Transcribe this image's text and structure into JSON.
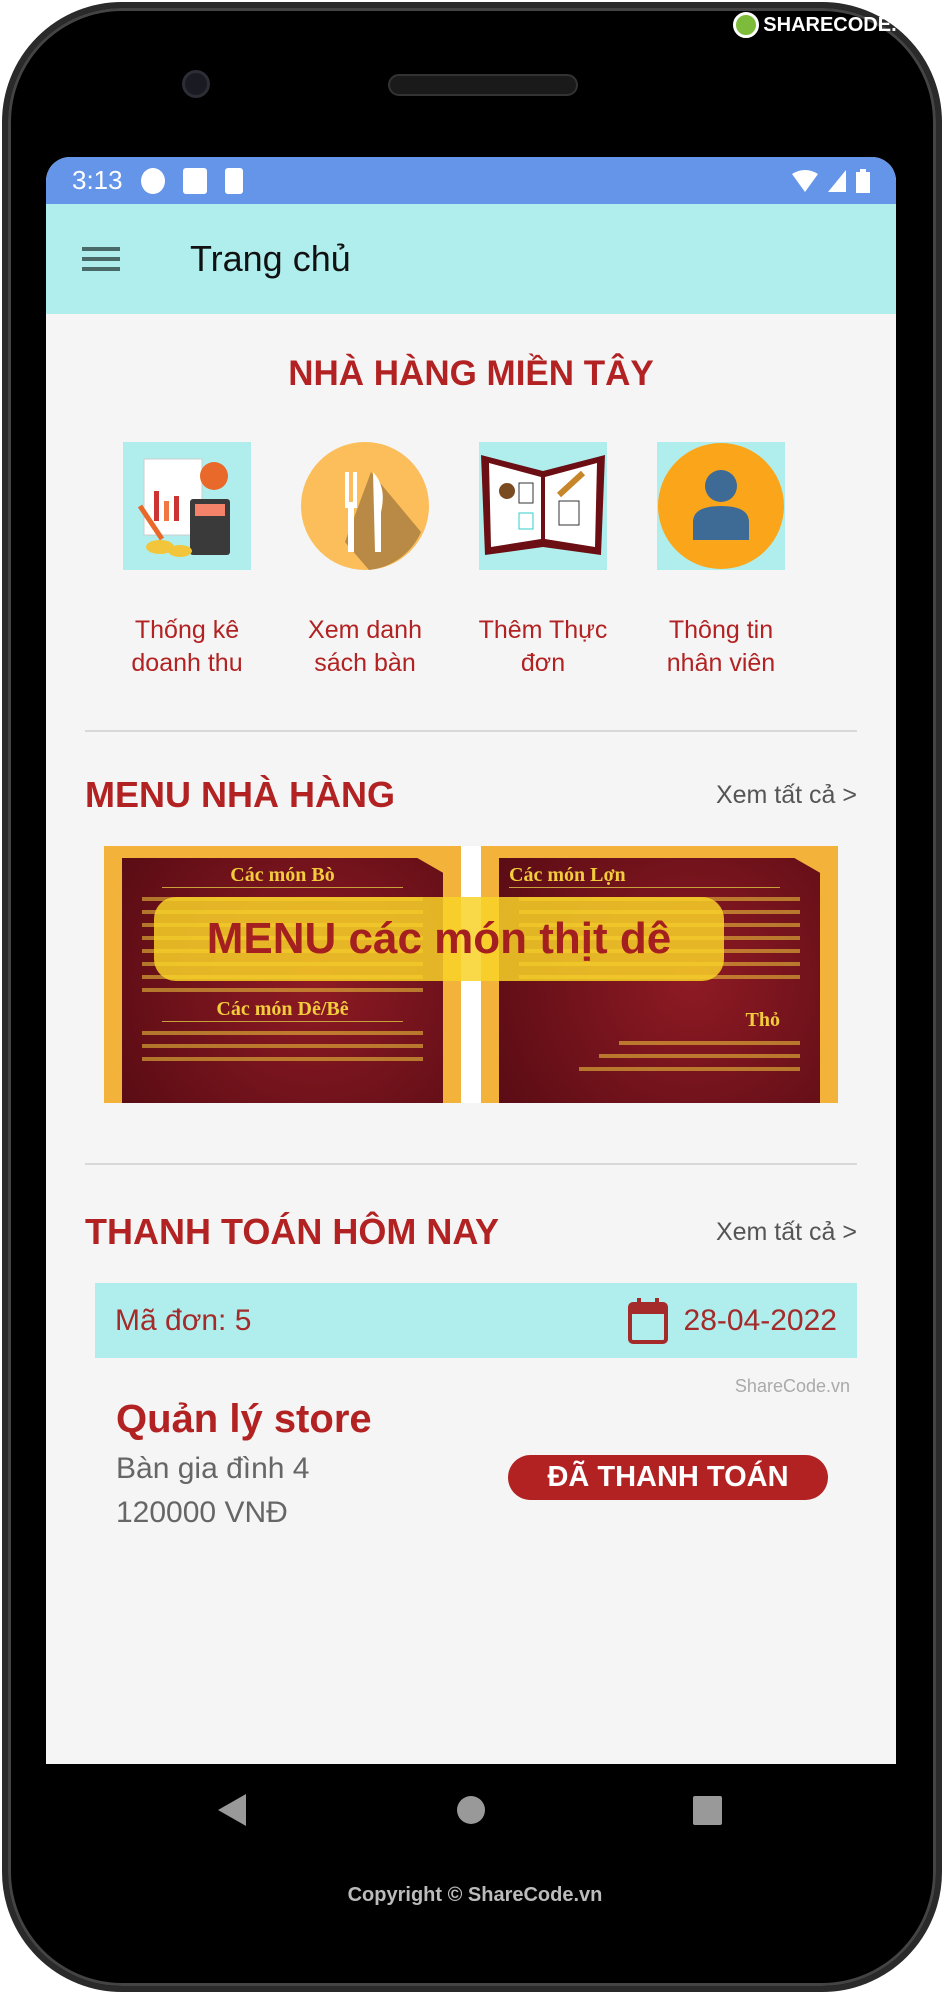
{
  "brand": {
    "watermark_logo": "SHARECODE.vn"
  },
  "status_bar": {
    "time": "3:13",
    "icons": [
      "settings-icon",
      "gmail-icon",
      "sd-card-icon",
      "wifi-icon",
      "signal-icon",
      "battery-icon"
    ]
  },
  "toolbar": {
    "menu_icon": "hamburger-icon",
    "title": "Trang chủ"
  },
  "header": {
    "title": "NHÀ HÀNG MIỀN TÂY"
  },
  "features": [
    {
      "label": "Thống kê doanh thu",
      "icon": "statistics-icon"
    },
    {
      "label": "Xem danh sách bàn",
      "icon": "fork-knife-icon"
    },
    {
      "label": "Thêm Thực đơn",
      "icon": "menu-book-icon"
    },
    {
      "label": "Thông tin nhân viên",
      "icon": "user-icon"
    }
  ],
  "menu_section": {
    "title": "MENU NHÀ HÀNG",
    "see_all": "Xem tất cả >",
    "banner": {
      "overlay_text": "MENU các món thịt dê",
      "panel_left_heading": "Các món Bò",
      "panel_left_heading2": "Các món Dê/Bê",
      "panel_right_heading": "Các món Lợn",
      "panel_right_heading2": "Thỏ"
    }
  },
  "payments_section": {
    "title": "THANH TOÁN HÔM NAY",
    "see_all": "Xem tất cả >",
    "order": {
      "id_label": "Mã đơn: 5",
      "date": "28-04-2022",
      "customer": "Quản lý store",
      "table": "Bàn gia đình 4",
      "amount": "120000 VNĐ",
      "status": "ĐÃ THANH TOÁN"
    },
    "watermark": "ShareCode.vn"
  },
  "colors": {
    "accent": "#b22222",
    "status_bar": "#6495e8",
    "toolbar": "#b0eeee",
    "background": "#f5f5f5"
  },
  "footer": {
    "copyright": "Copyright © ShareCode.vn"
  }
}
